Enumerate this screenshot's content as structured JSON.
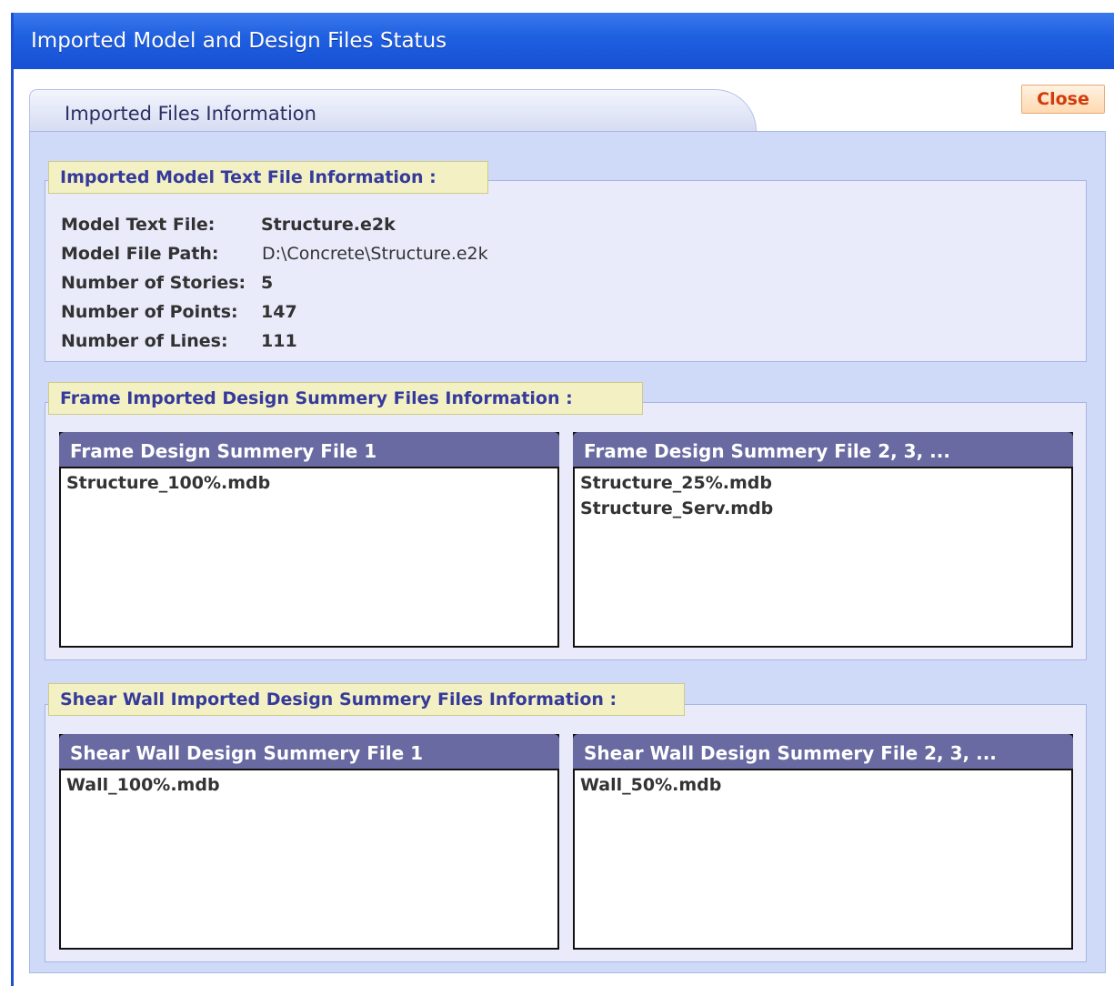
{
  "window": {
    "title": "Imported Model and Design Files Status"
  },
  "tab": {
    "label": "Imported Files Information"
  },
  "close_button": {
    "label": "Close"
  },
  "model_info": {
    "legend": "Imported Model Text File Information :",
    "rows": [
      {
        "label": "Model Text File:",
        "value": "Structure.e2k"
      },
      {
        "label": "Model File Path:",
        "value": "D:\\Concrete\\Structure.e2k"
      },
      {
        "label": "Number of Stories:",
        "value": "5"
      },
      {
        "label": "Number of Points:",
        "value": "147"
      },
      {
        "label": "Number of Lines:",
        "value": "111"
      }
    ]
  },
  "frame_section": {
    "legend": "Frame Imported Design Summery Files Information :",
    "list1": {
      "header": "Frame Design Summery  File 1",
      "items": [
        "Structure_100%.mdb"
      ]
    },
    "list2": {
      "header": "Frame Design Summery  File 2, 3, ...",
      "items": [
        "Structure_25%.mdb",
        "Structure_Serv.mdb"
      ]
    }
  },
  "wall_section": {
    "legend": "Shear Wall Imported Design Summery Files Information :",
    "list1": {
      "header": "Shear Wall Design Summery  File 1",
      "items": [
        "Wall_100%.mdb"
      ]
    },
    "list2": {
      "header": "Shear Wall Design Summery  File 2, 3, ...",
      "items": [
        "Wall_50%.mdb"
      ]
    }
  },
  "colors": {
    "titlebar": "#1e5fe0",
    "panel": "#cfdaf8",
    "list_header": "#686aa1",
    "legend_bg": "#f3f1c4",
    "close_text": "#d23c0a"
  }
}
